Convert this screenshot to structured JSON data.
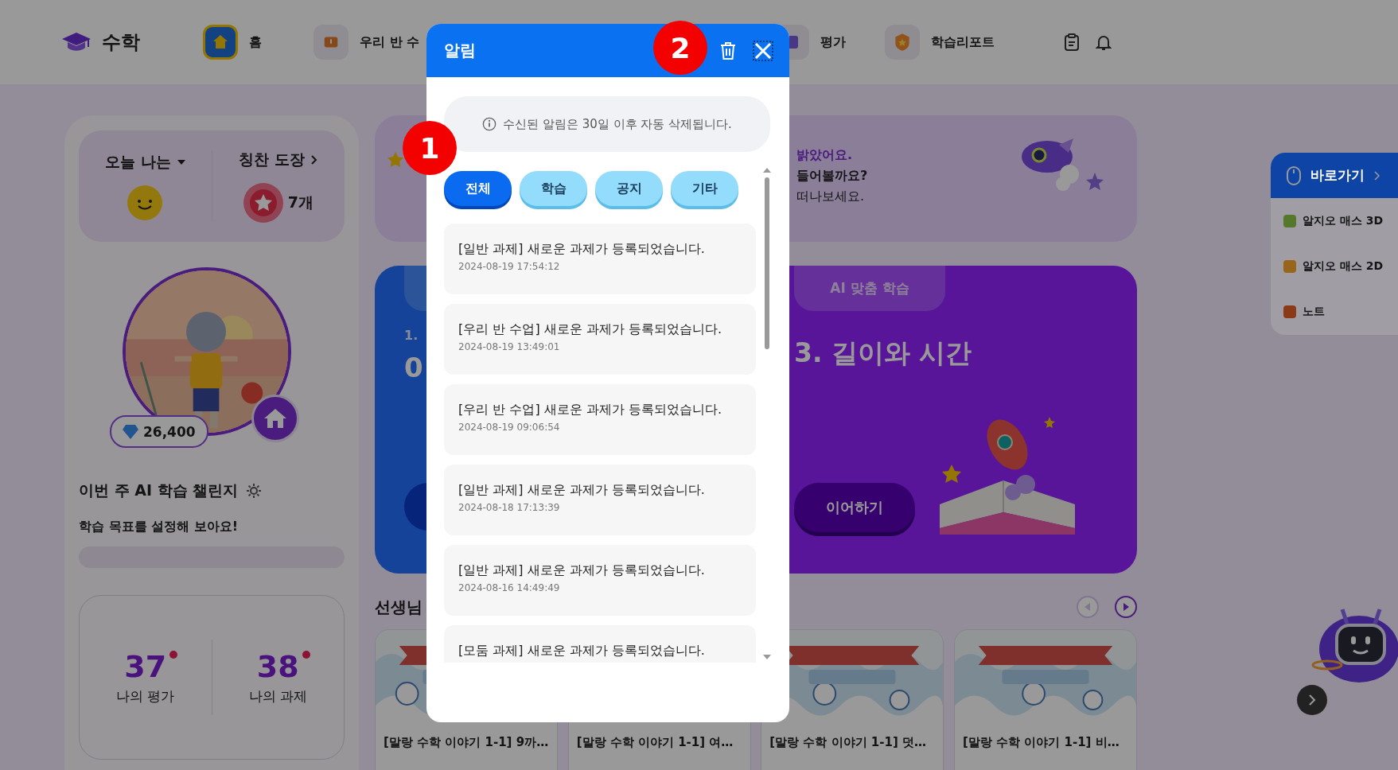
{
  "header": {
    "logo": "수학",
    "nav": [
      {
        "label": "홈",
        "selected": true
      },
      {
        "label": "우리 반 수",
        "selected": false
      },
      {
        "label": "평가",
        "selected": false
      },
      {
        "label": "학습리포트",
        "selected": false
      }
    ]
  },
  "profile": {
    "mood_label": "오늘 나는",
    "stamp_label": "칭찬 도장",
    "stamp_count": "7개",
    "gems": "26,400",
    "challenge_title": "이번 주 AI 학습 챌린지",
    "challenge_hint": "학습 목표를 설정해 보아요!",
    "progress": {
      "level": 0
    },
    "stats": [
      {
        "value": "37",
        "label": "나의 평가",
        "new": true
      },
      {
        "value": "38",
        "label": "나의 과제",
        "new": true
      }
    ]
  },
  "banner": {
    "lines": [
      "밝았어요.",
      "들어볼까요?",
      "떠나보세요."
    ]
  },
  "lesson": {
    "left_heading": "1.",
    "left_number": "0",
    "tab": "AI 맞춤 학습",
    "title": "3. 길이와 시간",
    "button": "이어하기"
  },
  "teacher": {
    "title": "선생님",
    "prev_disabled": true,
    "next_disabled": false,
    "cards": [
      {
        "caption": "[말랑 수학 이야기 1-1] 9까…"
      },
      {
        "caption": "[말랑 수학 이야기 1-1] 여…"
      },
      {
        "caption": "[말랑 수학 이야기 1-1] 덧…"
      },
      {
        "caption": "[말랑 수학 이야기 1-1] 비…"
      }
    ]
  },
  "quick": {
    "title": "바로가기",
    "items": [
      {
        "label": "알지오 매스 3D",
        "color": "#56782a"
      },
      {
        "label": "알지오 매스 2D",
        "color": "#97661a"
      },
      {
        "label": "노트",
        "color": "#8b3a17"
      }
    ]
  },
  "modal": {
    "title": "알림",
    "notice": "수신된 알림은 30일 이후 자동 삭제됩니다.",
    "filters": [
      {
        "label": "전체",
        "selected": true
      },
      {
        "label": "학습",
        "selected": false
      },
      {
        "label": "공지",
        "selected": false
      },
      {
        "label": "기타",
        "selected": false
      }
    ],
    "items": [
      {
        "text": "[일반 과제] 새로운 과제가 등록되었습니다.",
        "time": "2024-08-19 17:54:12"
      },
      {
        "text": "[우리 반 수업] 새로운 과제가 등록되었습니다.",
        "time": "2024-08-19 13:49:01"
      },
      {
        "text": "[우리 반 수업] 새로운 과제가 등록되었습니다.",
        "time": "2024-08-19 09:06:54"
      },
      {
        "text": "[일반 과제] 새로운 과제가 등록되었습니다.",
        "time": "2024-08-18 17:13:39"
      },
      {
        "text": "[일반 과제] 새로운 과제가 등록되었습니다.",
        "time": "2024-08-16 14:49:49"
      },
      {
        "text": "[모둠 과제] 새로운 과제가 등록되었습니다."
      }
    ]
  },
  "callouts": [
    "1",
    "2"
  ]
}
